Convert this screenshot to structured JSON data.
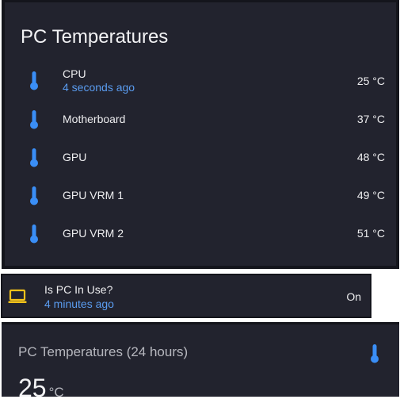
{
  "card_temps": {
    "title": "PC Temperatures",
    "sensors": [
      {
        "name": "CPU",
        "subtitle": "4 seconds ago",
        "value": "25 °C"
      },
      {
        "name": "Motherboard",
        "value": "37 °C"
      },
      {
        "name": "GPU",
        "value": "48 °C"
      },
      {
        "name": "GPU VRM 1",
        "value": "49 °C"
      },
      {
        "name": "GPU VRM 2",
        "value": "51 °C"
      }
    ]
  },
  "card_inuse": {
    "name": "Is PC In Use?",
    "subtitle": "4 minutes ago",
    "state": "On"
  },
  "card_graph": {
    "title": "PC Temperatures (24 hours)",
    "value": "25",
    "unit": "°C"
  },
  "icons": {
    "thermometer": "thermometer-icon",
    "laptop": "laptop-icon"
  },
  "colors": {
    "card_bg": "#22232e",
    "accent_blue": "#3a8ef6",
    "secondary_text": "#5a9cf0",
    "laptop_yellow": "#f2c21a"
  }
}
